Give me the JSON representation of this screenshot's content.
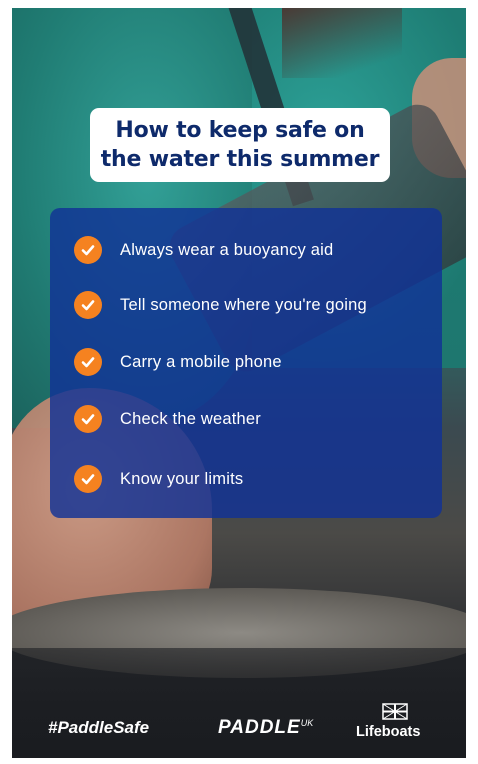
{
  "title": {
    "line1": "How to keep safe on",
    "line2": "the water this summer"
  },
  "checklist": [
    {
      "label": "Always wear a buoyancy aid",
      "icon": "check-icon"
    },
    {
      "label": "Tell someone where you're going",
      "icon": "check-icon"
    },
    {
      "label": "Carry a mobile phone",
      "icon": "check-icon"
    },
    {
      "label": "Check the weather",
      "icon": "check-icon"
    },
    {
      "label": "Know your limits",
      "icon": "check-icon"
    }
  ],
  "footer": {
    "hashtag": "#PaddleSafe",
    "paddle_brand": "PADDLE",
    "paddle_suffix": "UK",
    "lifeboats_text": "Lifeboats",
    "lifeboats_icon": "flag-icon"
  },
  "colors": {
    "title_text": "#0e2a6b",
    "panel": "#11329a",
    "check": "#f58220"
  }
}
